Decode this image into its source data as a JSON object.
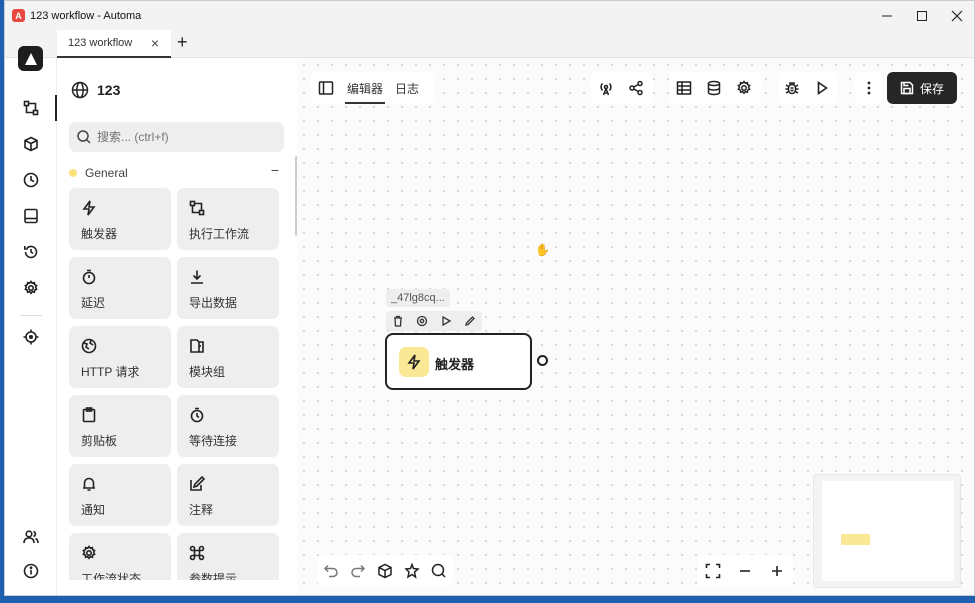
{
  "window": {
    "title": "123 workflow - Automa",
    "app_icon_glyph": "A",
    "controls": [
      "minimize-icon",
      "maximize-icon",
      "close-icon"
    ]
  },
  "tabs": [
    {
      "label": "123 workflow"
    }
  ],
  "rail": {
    "items": [
      "workflow-icon",
      "package-icon",
      "clock-icon",
      "storage-icon",
      "history-icon",
      "settings-icon",
      "crosshair-icon"
    ],
    "bottom": [
      "users-icon",
      "info-icon"
    ]
  },
  "panel": {
    "title": "123",
    "search_placeholder": "搜索... (ctrl+f)",
    "category": "General",
    "collapse_symbol": "−",
    "blocks": [
      {
        "label": "触发器",
        "icon": "bolt-icon"
      },
      {
        "label": "执行工作流",
        "icon": "workflow-icon"
      },
      {
        "label": "延迟",
        "icon": "stopwatch-icon"
      },
      {
        "label": "导出数据",
        "icon": "download-icon"
      },
      {
        "label": "HTTP 请求",
        "icon": "globe-icon"
      },
      {
        "label": "模块组",
        "icon": "folder-icon"
      },
      {
        "label": "剪贴板",
        "icon": "clipboard-icon"
      },
      {
        "label": "等待连接",
        "icon": "timer-icon"
      },
      {
        "label": "通知",
        "icon": "bell-icon"
      },
      {
        "label": "注释",
        "icon": "note-icon"
      },
      {
        "label": "工作流状态",
        "icon": "settings-icon"
      },
      {
        "label": "参数提示",
        "icon": "command-icon"
      }
    ]
  },
  "toolbar": {
    "tab_editor": "编辑器",
    "tab_log": "日志",
    "save_label": "保存"
  },
  "node": {
    "id": "_47lg8cq...",
    "label": "触发器"
  },
  "colors": {
    "accent": "#262626",
    "trigger": "#fbe897",
    "category_dot": "#f9e27a"
  }
}
